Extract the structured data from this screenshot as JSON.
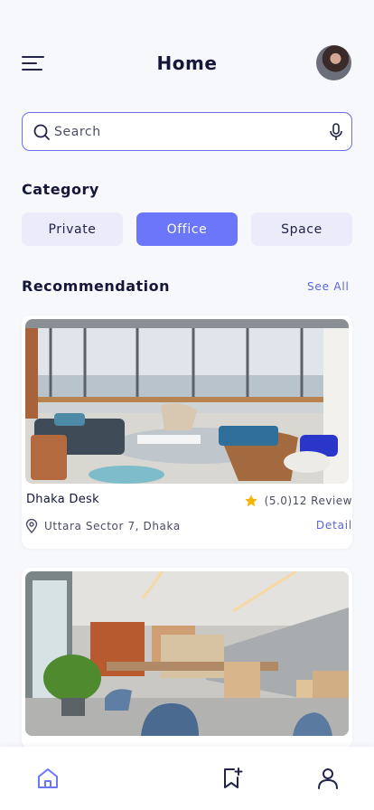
{
  "header": {
    "title": "Home",
    "menu_icon": "hamburger-menu-icon",
    "avatar_icon": "user-avatar"
  },
  "search": {
    "placeholder": "Search",
    "value": "",
    "icons": [
      "search-icon",
      "mic-icon"
    ]
  },
  "category": {
    "title": "Category",
    "chips": [
      {
        "label": "Private",
        "active": false
      },
      {
        "label": "Office",
        "active": true
      },
      {
        "label": "Space",
        "active": false
      }
    ]
  },
  "recommendation": {
    "title": "Recommendation",
    "see_all": "See All",
    "cards": [
      {
        "name": "Dhaka Desk",
        "rating": "(5.0)12 Review",
        "location": "Uttara Sector 7, Dhaka",
        "detail": "Detail",
        "image": "office-lounge-photo"
      },
      {
        "image": "coworking-space-photo"
      }
    ]
  },
  "bottom_nav": {
    "items": [
      "home-icon",
      "bookmark-add-icon",
      "profile-icon"
    ],
    "active": "home-icon"
  },
  "colors": {
    "accent": "#6b76f8",
    "accent_text": "#5a64e0",
    "chip_bg": "#ebebf9",
    "background": "#f7f8fc",
    "title": "#14163a",
    "star": "#f5b400"
  }
}
